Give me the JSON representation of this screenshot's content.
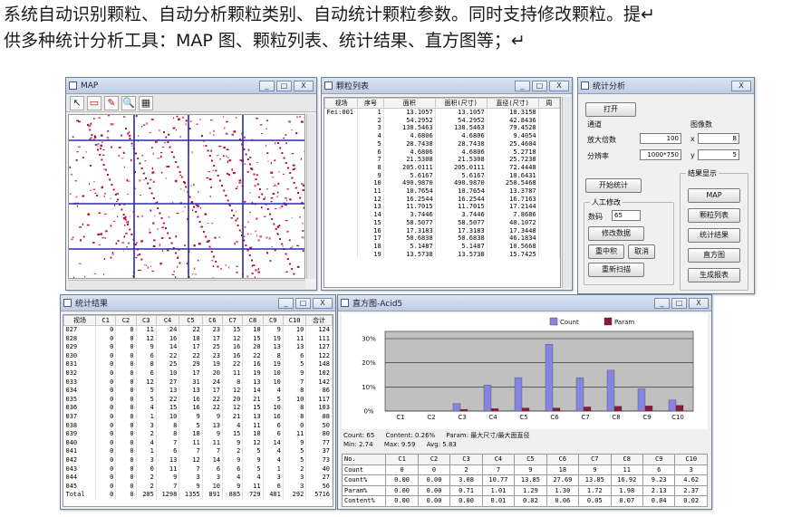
{
  "intro": {
    "line1": "系统自动识别颗粒、自动分析颗粒类别、自动统计颗粒参数。同时支持修改颗粒。提↵",
    "line2": "供多种统计分析工具：MAP 图、颗粒列表、统计结果、直方图等；↵"
  },
  "map_window": {
    "title": "MAP",
    "tools": [
      "↖",
      "▭",
      "✎",
      "🔍",
      "▦"
    ],
    "window_buttons": [
      "_",
      "□",
      "X"
    ]
  },
  "list_window": {
    "title": "颗粒列表",
    "window_buttons": [
      "_",
      "□",
      "X"
    ],
    "columns": [
      "视场",
      "序号",
      "面积",
      "面积(尺寸)",
      "直径(尺寸)",
      "周"
    ],
    "rows": [
      [
        "Fei:001",
        "1",
        "13.1057",
        "13.1057",
        "10.3158"
      ],
      [
        "",
        "2",
        "54.2952",
        "54.2952",
        "42.8436"
      ],
      [
        "",
        "3",
        "138.5463",
        "138.5463",
        "79.4528"
      ],
      [
        "",
        "4",
        "4.6806",
        "4.6806",
        "9.4054"
      ],
      [
        "",
        "5",
        "28.7438",
        "28.7438",
        "25.4604"
      ],
      [
        "",
        "6",
        "4.6806",
        "4.6806",
        "5.2718"
      ],
      [
        "",
        "7",
        "21.5308",
        "21.5308",
        "25.7238"
      ],
      [
        "",
        "8",
        "205.0111",
        "205.0111",
        "72.4448"
      ],
      [
        "",
        "9",
        "5.6167",
        "5.6167",
        "10.6431"
      ],
      [
        "",
        "10",
        "490.9870",
        "490.9870",
        "250.5468"
      ],
      [
        "",
        "11",
        "10.7654",
        "10.7654",
        "13.3787"
      ],
      [
        "",
        "12",
        "16.2544",
        "16.2544",
        "16.7163"
      ],
      [
        "",
        "13",
        "11.7015",
        "11.7015",
        "17.2144"
      ],
      [
        "",
        "14",
        "3.7446",
        "3.7446",
        "7.8686"
      ],
      [
        "",
        "15",
        "58.5077",
        "58.5077",
        "40.1072"
      ],
      [
        "",
        "16",
        "17.3183",
        "17.3183",
        "17.3448"
      ],
      [
        "",
        "17",
        "50.6838",
        "50.6838",
        "46.1834"
      ],
      [
        "",
        "18",
        "5.1487",
        "5.1487",
        "10.5668"
      ],
      [
        "",
        "19",
        "13.5738",
        "13.5738",
        "15.7425"
      ]
    ]
  },
  "analysis_panel": {
    "title": "统计分析",
    "open_button": "打开",
    "channel_label": "通道",
    "magnification_label": "放大倍数",
    "magnification_value": "100",
    "resolution_label": "分辨率",
    "resolution_value": "1000*750",
    "fields_label": "图像数",
    "fields_x": "8",
    "fields_y": "5",
    "start_stats_button": "开始统计",
    "manual_group": "人工修改",
    "count_label": "数码",
    "count_value": "65",
    "modify_button": "修改数据",
    "recount_button": "重中积",
    "cancel_button": "取消",
    "rescan_button": "重新扫描",
    "results_group": "结果显示",
    "result_buttons": [
      "MAP",
      "颗粒列表",
      "统计结果",
      "直方图",
      "生成报表"
    ]
  },
  "stats_window": {
    "title": "统计结果",
    "window_buttons": [
      "_",
      "□",
      "X"
    ],
    "columns": [
      "视场",
      "C1",
      "C2",
      "C3",
      "C4",
      "C5",
      "C6",
      "C7",
      "C8",
      "C9",
      "C10",
      "合计"
    ],
    "rows": [
      [
        "027",
        "0",
        "0",
        "11",
        "24",
        "22",
        "23",
        "15",
        "10",
        "9",
        "10",
        "124"
      ],
      [
        "028",
        "0",
        "0",
        "12",
        "16",
        "18",
        "17",
        "12",
        "15",
        "19",
        "11",
        "111"
      ],
      [
        "029",
        "0",
        "0",
        "9",
        "14",
        "17",
        "25",
        "16",
        "20",
        "13",
        "13",
        "127"
      ],
      [
        "030",
        "0",
        "0",
        "6",
        "22",
        "22",
        "23",
        "16",
        "22",
        "8",
        "6",
        "122"
      ],
      [
        "031",
        "0",
        "0",
        "8",
        "25",
        "29",
        "19",
        "22",
        "16",
        "19",
        "5",
        "148"
      ],
      [
        "032",
        "0",
        "0",
        "6",
        "10",
        "17",
        "20",
        "11",
        "19",
        "10",
        "9",
        "102"
      ],
      [
        "033",
        "0",
        "0",
        "12",
        "27",
        "31",
        "24",
        "8",
        "13",
        "10",
        "7",
        "142"
      ],
      [
        "034",
        "0",
        "0",
        "5",
        "13",
        "13",
        "17",
        "12",
        "14",
        "4",
        "8",
        "86"
      ],
      [
        "035",
        "0",
        "0",
        "5",
        "22",
        "16",
        "22",
        "20",
        "21",
        "5",
        "10",
        "117"
      ],
      [
        "036",
        "0",
        "0",
        "4",
        "15",
        "16",
        "22",
        "12",
        "15",
        "10",
        "8",
        "103"
      ],
      [
        "037",
        "0",
        "0",
        "1",
        "10",
        "9",
        "9",
        "21",
        "13",
        "16",
        "8",
        "88"
      ],
      [
        "038",
        "0",
        "0",
        "3",
        "8",
        "5",
        "13",
        "4",
        "11",
        "6",
        "0",
        "50"
      ],
      [
        "039",
        "0",
        "0",
        "2",
        "8",
        "18",
        "9",
        "15",
        "10",
        "6",
        "11",
        "80"
      ],
      [
        "040",
        "0",
        "0",
        "4",
        "7",
        "11",
        "11",
        "9",
        "12",
        "14",
        "9",
        "77"
      ],
      [
        "041",
        "0",
        "0",
        "1",
        "6",
        "7",
        "7",
        "2",
        "5",
        "4",
        "5",
        "37"
      ],
      [
        "042",
        "0",
        "0",
        "3",
        "13",
        "12",
        "14",
        "9",
        "9",
        "4",
        "5",
        "73"
      ],
      [
        "043",
        "0",
        "0",
        "0",
        "11",
        "7",
        "6",
        "6",
        "5",
        "1",
        "2",
        "40"
      ],
      [
        "044",
        "0",
        "0",
        "2",
        "9",
        "3",
        "3",
        "4",
        "4",
        "3",
        "3",
        "27"
      ],
      [
        "045",
        "0",
        "0",
        "2",
        "7",
        "9",
        "10",
        "9",
        "11",
        "6",
        "3",
        "56"
      ],
      [
        "Total",
        "0",
        "0",
        "205",
        "1298",
        "1355",
        "891",
        "885",
        "729",
        "481",
        "292",
        "5716"
      ]
    ]
  },
  "histogram_window": {
    "title": "直方图-Acid5",
    "window_buttons": [
      "_",
      "□",
      "X"
    ],
    "info": {
      "count": "Count: 65",
      "content": "Content: 0.26%",
      "param": "Param: 最大尺寸/最大面直径",
      "min": "Min: 2.74",
      "max": "Max: 9.59",
      "avg": "Avg: 5.83"
    },
    "table": {
      "header": [
        "No.",
        "C1",
        "C2",
        "C3",
        "C4",
        "C5",
        "C6",
        "C7",
        "C8",
        "C9",
        "C10"
      ],
      "rows": [
        [
          "Count",
          "0",
          "0",
          "2",
          "7",
          "9",
          "18",
          "9",
          "11",
          "6",
          "3"
        ],
        [
          "Count%",
          "0.00",
          "0.00",
          "3.08",
          "10.77",
          "13.85",
          "27.69",
          "13.85",
          "16.92",
          "9.23",
          "4.62"
        ],
        [
          "Param%",
          "0.00",
          "0.00",
          "0.71",
          "1.01",
          "1.29",
          "1.30",
          "1.72",
          "1.98",
          "2.13",
          "2.37"
        ],
        [
          "Content%",
          "0.00",
          "0.00",
          "0.00",
          "0.01",
          "0.02",
          "0.06",
          "0.05",
          "0.07",
          "0.04",
          "0.02"
        ]
      ]
    }
  },
  "chart_data": {
    "type": "bar",
    "categories": [
      "C1",
      "C2",
      "C3",
      "C4",
      "C5",
      "C6",
      "C7",
      "C8",
      "C9",
      "C10"
    ],
    "series": [
      {
        "name": "Count",
        "color": "#8585e0",
        "values": [
          0,
          0,
          3.08,
          10.77,
          13.85,
          27.69,
          13.85,
          16.92,
          9.23,
          4.62
        ]
      },
      {
        "name": "Param",
        "color": "#8b1a3a",
        "values": [
          0,
          0,
          0.71,
          1.01,
          1.29,
          1.3,
          1.72,
          1.98,
          2.13,
          2.37
        ]
      }
    ],
    "yticks": [
      "30%",
      "20%",
      "10%",
      "0%"
    ],
    "ylim": [
      0,
      33
    ],
    "legend_position": "top-right",
    "grid": true,
    "plot_background": "#c0c0c0"
  }
}
